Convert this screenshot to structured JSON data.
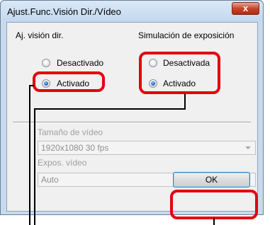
{
  "window": {
    "title": "Ajust.Func.Visión Dir./Vídeo",
    "close_glyph": "x"
  },
  "live_view": {
    "heading": "Aj. visión dir.",
    "option_off": "Desactivado",
    "option_on": "Activado",
    "selected": "Activado"
  },
  "exposure_sim": {
    "heading": "Simulación de exposición",
    "option_off": "Desactivada",
    "option_on": "Activado",
    "selected": "Activado"
  },
  "video": {
    "size_label": "Tamaño de vídeo",
    "size_value": "1920x1080  30 fps",
    "exposure_label": "Expos. vídeo",
    "exposure_value": "Auto"
  },
  "buttons": {
    "ok": "OK"
  },
  "highlight_color": "#e3000f"
}
